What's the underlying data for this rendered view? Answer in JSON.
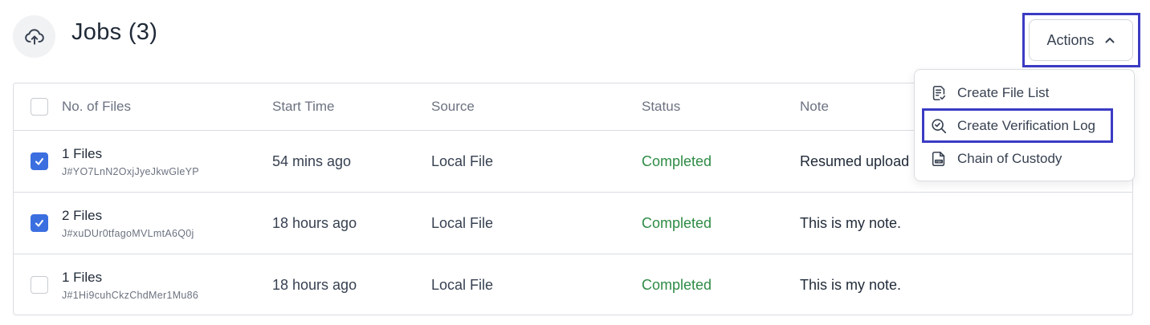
{
  "header": {
    "icon": "cloud-upload-icon",
    "title": "Jobs (3)"
  },
  "actions": {
    "label": "Actions",
    "icon": "chevron-up-icon"
  },
  "table": {
    "columns": [
      "No. of Files",
      "Start Time",
      "Source",
      "Status",
      "Note"
    ],
    "rows": [
      {
        "checked": true,
        "files": "1 Files",
        "id": "J#YO7LnN2OxjJyeJkwGleYP",
        "start_time": "54 mins ago",
        "source": "Local File",
        "status": "Completed",
        "note": "Resumed upload"
      },
      {
        "checked": true,
        "files": "2 Files",
        "id": "J#xuDUr0tfagoMVLmtA6Q0j",
        "start_time": "18 hours ago",
        "source": "Local File",
        "status": "Completed",
        "note": "This is my note."
      },
      {
        "checked": false,
        "files": "1 Files",
        "id": "J#1Hi9cuhCkzChdMer1Mu86",
        "start_time": "18 hours ago",
        "source": "Local File",
        "status": "Completed",
        "note": "This is my note."
      }
    ]
  },
  "dropdown": {
    "items": [
      {
        "label": "Create File List",
        "icon": "file-list-icon"
      },
      {
        "label": "Create Verification Log",
        "icon": "search-check-icon"
      },
      {
        "label": "Chain of Custody",
        "icon": "pdf-file-icon"
      }
    ]
  },
  "colors": {
    "accent": "#3b6fe0",
    "highlight": "#3b3bc4",
    "status_completed": "#2e8b45"
  }
}
